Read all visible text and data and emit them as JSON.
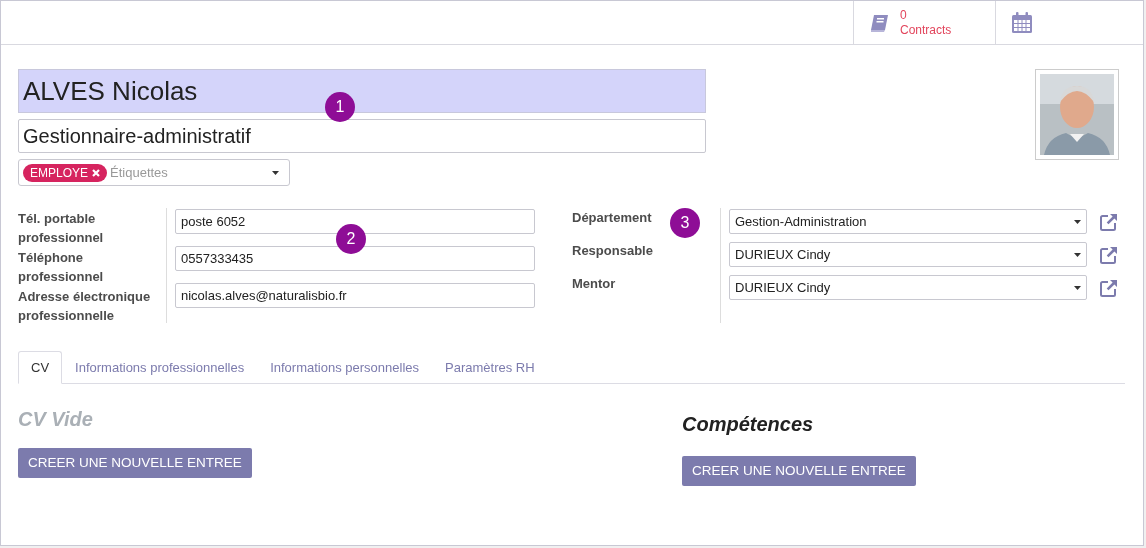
{
  "header_buttons": [
    {
      "kind": "contracts",
      "count": "0",
      "label": "Contracts"
    },
    {
      "kind": "calendar"
    }
  ],
  "employee": {
    "name": "ALVES Nicolas",
    "job_title": "Gestionnaire-administratif",
    "tags": [
      {
        "label": "EMPLOYE",
        "color": "#d6245f"
      }
    ],
    "tags_placeholder": "Étiquettes"
  },
  "contact_fields": [
    {
      "label": "Tél. portable professionnel",
      "value": "poste 6052"
    },
    {
      "label": "Téléphone professionnel",
      "value": "0557333435"
    },
    {
      "label": "Adresse électronique professionnelle",
      "value": "nicolas.alves@naturalisbio.fr"
    }
  ],
  "relation_fields": [
    {
      "label": "Département",
      "value": "Gestion-Administration"
    },
    {
      "label": "Responsable",
      "value": "DURIEUX Cindy"
    },
    {
      "label": "Mentor",
      "value": "DURIEUX Cindy"
    }
  ],
  "markers": [
    "1",
    "2",
    "3"
  ],
  "tabs": [
    {
      "label": "CV",
      "selected": true
    },
    {
      "label": "Informations professionnelles",
      "selected": false
    },
    {
      "label": "Informations personnelles",
      "selected": false
    },
    {
      "label": "Paramètres RH",
      "selected": false
    }
  ],
  "cv": {
    "empty_title": "CV Vide",
    "button": "CREER UNE NOUVELLE ENTREE"
  },
  "skills": {
    "title": "Compétences",
    "button": "CREER UNE NOUVELLE ENTREE"
  }
}
